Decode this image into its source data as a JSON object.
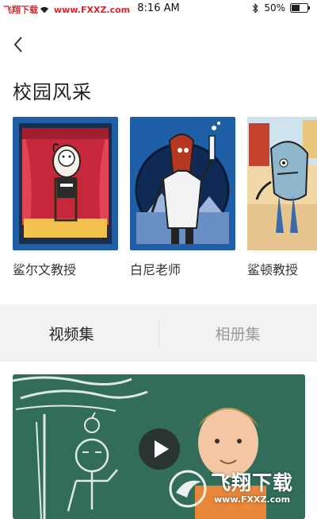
{
  "status_bar": {
    "carrier": "飞翔下载",
    "url": "www.FXXZ.com",
    "time": "8:16 AM",
    "battery": "50%"
  },
  "nav": {
    "back_icon": "chevron-left-icon"
  },
  "section": {
    "title": "校园风采"
  },
  "cards": [
    {
      "name": "鲨尔文教授",
      "illustration": "shark-on-stage",
      "background": "#1f5fa8"
    },
    {
      "name": "白尼老师",
      "illustration": "scientist-with-test-tube",
      "background": "#1f5fa8"
    },
    {
      "name": "鲨顿教授",
      "illustration": "shark-in-street",
      "background": "#f0d9a6"
    }
  ],
  "tabs": [
    {
      "label": "视频集",
      "active": true
    },
    {
      "label": "相册集",
      "active": false
    }
  ],
  "video": {
    "play_icon": "play-icon",
    "chalkboard_color": "#2f6b57"
  },
  "watermark": {
    "title": "飞翔下载",
    "url": "www.FXXZ.com"
  }
}
